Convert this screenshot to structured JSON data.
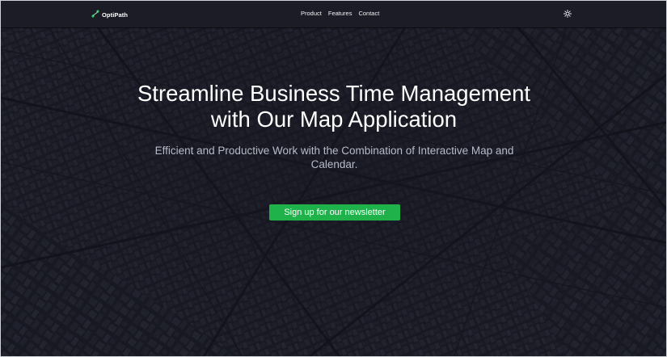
{
  "brand": {
    "name": "OptiPath",
    "logo_icon": "path-route-icon",
    "accent": "#22c55e"
  },
  "nav": {
    "links": [
      {
        "label": "Product"
      },
      {
        "label": "Features"
      },
      {
        "label": "Contact"
      }
    ],
    "theme_toggle_icon": "sun-icon"
  },
  "hero": {
    "title_line1": "Streamline Business Time Management",
    "title_line2": "with Our Map Application",
    "subtitle": "Efficient and Productive Work with the Combination of Interactive Map and Calendar.",
    "cta_label": "Sign up for our newsletter",
    "cta_color": "#1fb24a",
    "background": "dark-city-map-aerial"
  }
}
